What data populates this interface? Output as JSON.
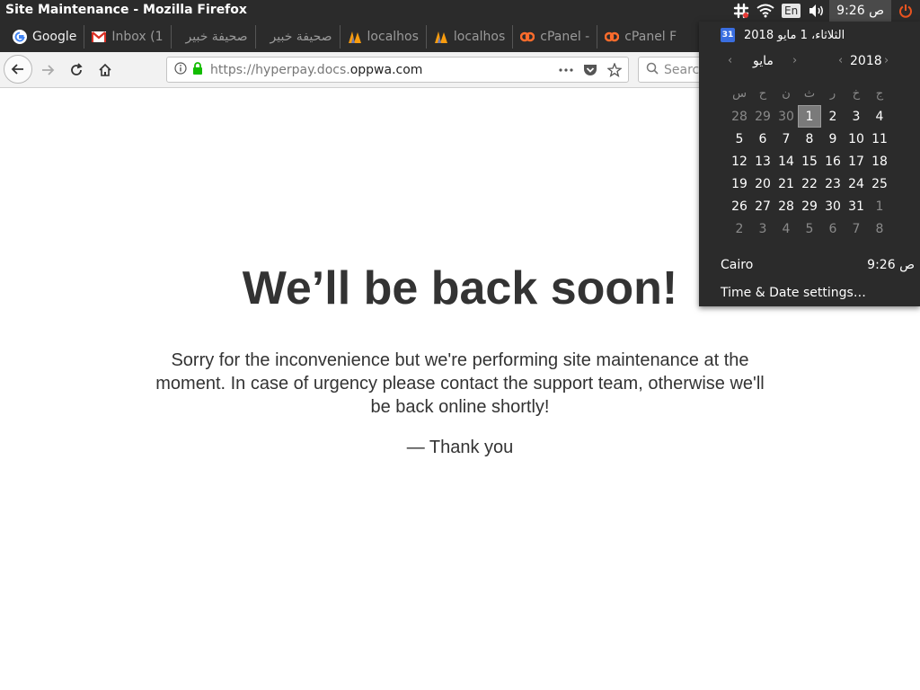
{
  "window": {
    "title": "Site Maintenance - Mozilla Firefox"
  },
  "tray": {
    "lang": "En",
    "clock": "9:26 ص"
  },
  "bookmarks": [
    {
      "label": "Google",
      "icon": "google-icon",
      "faded": false
    },
    {
      "label": "Inbox (1",
      "icon": "gmail-icon",
      "faded": true
    },
    {
      "label": "صحيفة خبير",
      "icon": "",
      "faded": false
    },
    {
      "label": "صحيفة خبير",
      "icon": "",
      "faded": false
    },
    {
      "label": "localhos",
      "icon": "phpmyadmin-icon",
      "faded": false
    },
    {
      "label": "localhos",
      "icon": "phpmyadmin-icon",
      "faded": false
    },
    {
      "label": "cPanel -",
      "icon": "cpanel-icon",
      "faded": false
    },
    {
      "label": "cPanel F",
      "icon": "cpanel-icon",
      "faded": false
    }
  ],
  "nav": {
    "url_prefix": "https://hyperpay.docs.",
    "url_domain": "oppwa.com",
    "search_placeholder": "Search"
  },
  "page": {
    "headline": "We’ll be back soon!",
    "message": "Sorry for the inconvenience but we're performing site maintenance at the moment. In case of urgency please contact the support team, otherwise we'll be back online shortly!",
    "signoff": "— Thank you"
  },
  "calendar": {
    "date_line": "الثلاثاء، 1 مايو 2018",
    "icon_number": "31",
    "month": "مايو",
    "year": "2018",
    "weekdays": [
      "س",
      "ح",
      "ن",
      "ث",
      "ر",
      "خ",
      "ج"
    ],
    "weeks": [
      [
        "28",
        "29",
        "30",
        "1",
        "2",
        "3",
        "4"
      ],
      [
        "5",
        "6",
        "7",
        "8",
        "9",
        "10",
        "11"
      ],
      [
        "12",
        "13",
        "14",
        "15",
        "16",
        "17",
        "18"
      ],
      [
        "19",
        "20",
        "21",
        "22",
        "23",
        "24",
        "25"
      ],
      [
        "26",
        "27",
        "28",
        "29",
        "30",
        "31",
        "1"
      ],
      [
        "2",
        "3",
        "4",
        "5",
        "6",
        "7",
        "8"
      ]
    ],
    "other_month": [
      [
        true,
        true,
        true,
        false,
        false,
        false,
        false
      ],
      [
        false,
        false,
        false,
        false,
        false,
        false,
        false
      ],
      [
        false,
        false,
        false,
        false,
        false,
        false,
        false
      ],
      [
        false,
        false,
        false,
        false,
        false,
        false,
        false
      ],
      [
        false,
        false,
        false,
        false,
        false,
        false,
        true
      ],
      [
        true,
        true,
        true,
        true,
        true,
        true,
        true
      ]
    ],
    "today": "1",
    "location_name": "Cairo",
    "location_time": "9:26 ص",
    "settings_label": "Time & Date settings…"
  }
}
